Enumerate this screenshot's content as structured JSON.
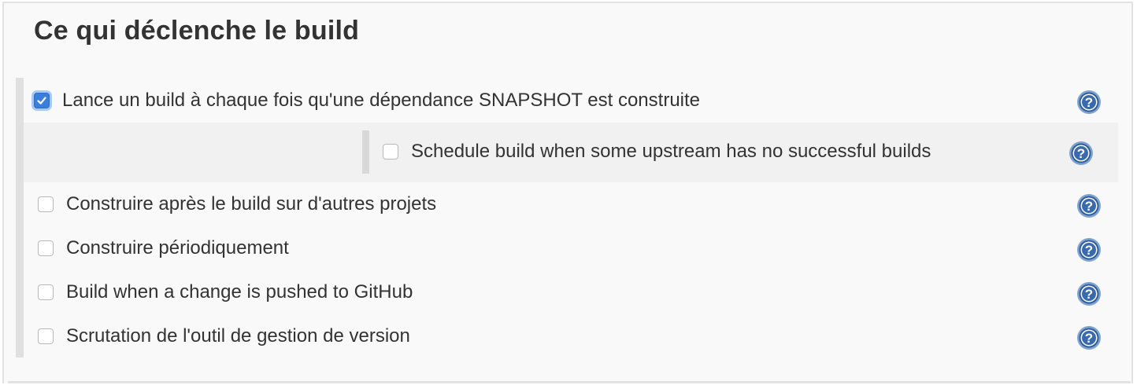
{
  "section": {
    "title": "Ce qui déclenche le build"
  },
  "triggers": [
    {
      "label": "Lance un build à chaque fois qu'une dépendance SNAPSHOT est construite",
      "checked": true
    },
    {
      "label": "Schedule build when some upstream has no successful builds",
      "checked": false,
      "nested": true
    },
    {
      "label": "Construire après le build sur d'autres projets",
      "checked": false
    },
    {
      "label": "Construire périodiquement",
      "checked": false
    },
    {
      "label": "Build when a change is pushed to GitHub",
      "checked": false
    },
    {
      "label": "Scrutation de l'outil de gestion de version",
      "checked": false
    }
  ],
  "icons": {
    "help": "help-icon",
    "check": "checkmark-icon"
  },
  "colors": {
    "accent": "#3b7fdc",
    "help_blue": "#2f5c9a"
  }
}
